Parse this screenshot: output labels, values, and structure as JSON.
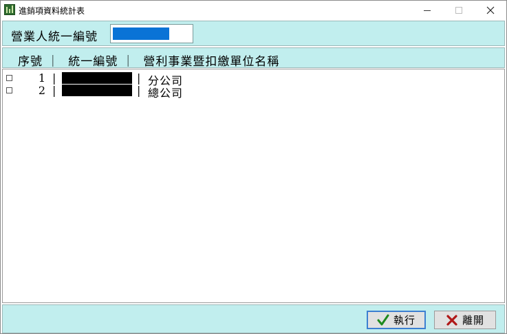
{
  "window": {
    "title": "進銷項資料統計表",
    "icon": "app-chart-icon",
    "controls": {
      "minimize": "minimize-icon",
      "maximize": "maximize-icon",
      "close": "close-icon"
    }
  },
  "filter": {
    "label": "營業人統一編號",
    "value": ""
  },
  "list": {
    "header": "序號 ｜  統一編號 ｜  營利事業暨扣繳單位名稱",
    "rows": [
      {
        "seq": "1",
        "sep": "|",
        "name": "分公司"
      },
      {
        "seq": "2",
        "sep": "|",
        "name": "總公司"
      }
    ]
  },
  "actions": {
    "execute_label": "執行",
    "exit_label": "離開"
  },
  "colors": {
    "panel": "#c1eeee",
    "selection": "#0a73d6",
    "execute_icon": "#1e8a1e",
    "exit_icon": "#b01818"
  }
}
